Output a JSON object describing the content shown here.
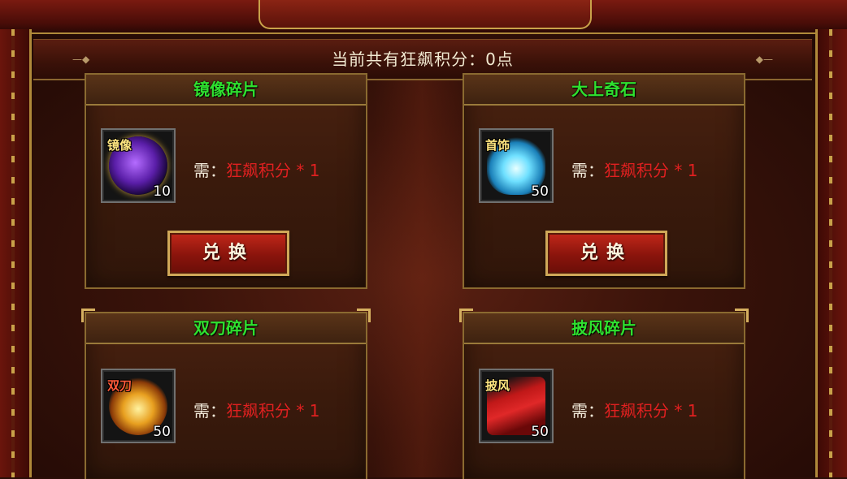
{
  "header": {
    "points_text": "当前共有狂飙积分：0点"
  },
  "cards": [
    {
      "title": "镜像碎片",
      "item_tag": "镜像",
      "quantity": "10",
      "req_label": "需：",
      "req_value": "狂飙积分 * 1",
      "button_label": "兑换",
      "icon": "purple-orb-icon"
    },
    {
      "title": "大上奇石",
      "item_tag": "首饰",
      "quantity": "50",
      "req_label": "需：",
      "req_value": "狂飙积分 * 1",
      "button_label": "兑换",
      "icon": "necklace-icon"
    },
    {
      "title": "双刀碎片",
      "item_tag": "双刀",
      "quantity": "50",
      "req_label": "需：",
      "req_value": "狂飙积分 * 1",
      "icon": "twin-blade-icon"
    },
    {
      "title": "披风碎片",
      "item_tag": "披风",
      "quantity": "50",
      "req_label": "需：",
      "req_value": "狂飙积分 * 1",
      "icon": "cape-icon"
    }
  ],
  "colors": {
    "title_green": "#2fe12f",
    "req_red": "#e02020",
    "gold_border": "#c9a24a"
  }
}
